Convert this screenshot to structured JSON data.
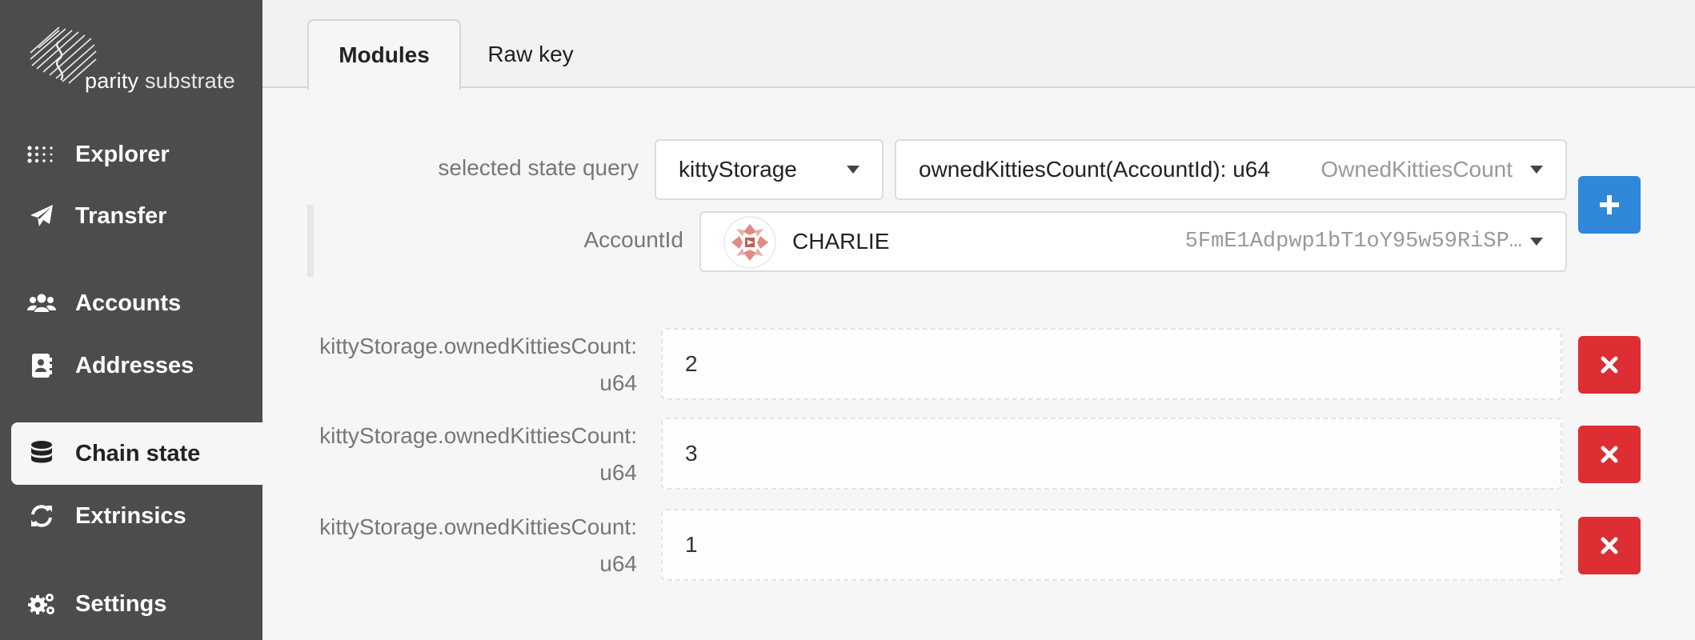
{
  "brand": {
    "name": "parity",
    "product": "substrate"
  },
  "sidebar": {
    "items": [
      {
        "label": "Explorer",
        "icon": "explorer-icon"
      },
      {
        "label": "Transfer",
        "icon": "paper-plane-icon"
      },
      {
        "label": "Accounts",
        "icon": "users-icon"
      },
      {
        "label": "Addresses",
        "icon": "address-book-icon"
      },
      {
        "label": "Chain state",
        "icon": "database-icon",
        "active": true
      },
      {
        "label": "Extrinsics",
        "icon": "sync-icon"
      },
      {
        "label": "Settings",
        "icon": "cogs-icon"
      }
    ]
  },
  "tabs": [
    {
      "label": "Modules",
      "active": true
    },
    {
      "label": "Raw key",
      "active": false
    }
  ],
  "query": {
    "label": "selected state query",
    "module": "kittyStorage",
    "method": "ownedKittiesCount(AccountId): u64",
    "method_hint": "OwnedKittiesCount",
    "param_label": "AccountId",
    "account_name": "CHARLIE",
    "account_address": "5FmE1Adpwp1bT1oY95w59RiSP…"
  },
  "results": [
    {
      "label_line1": "kittyStorage.ownedKittiesCount:",
      "label_line2": "u64",
      "value": "2"
    },
    {
      "label_line1": "kittyStorage.ownedKittiesCount:",
      "label_line2": "u64",
      "value": "3"
    },
    {
      "label_line1": "kittyStorage.ownedKittiesCount:",
      "label_line2": "u64",
      "value": "1"
    }
  ],
  "colors": {
    "sidebar_bg": "#4c4c4c",
    "add_button": "#2f88d8",
    "remove_button": "#dc2e33",
    "identicon": "#e08a84"
  }
}
